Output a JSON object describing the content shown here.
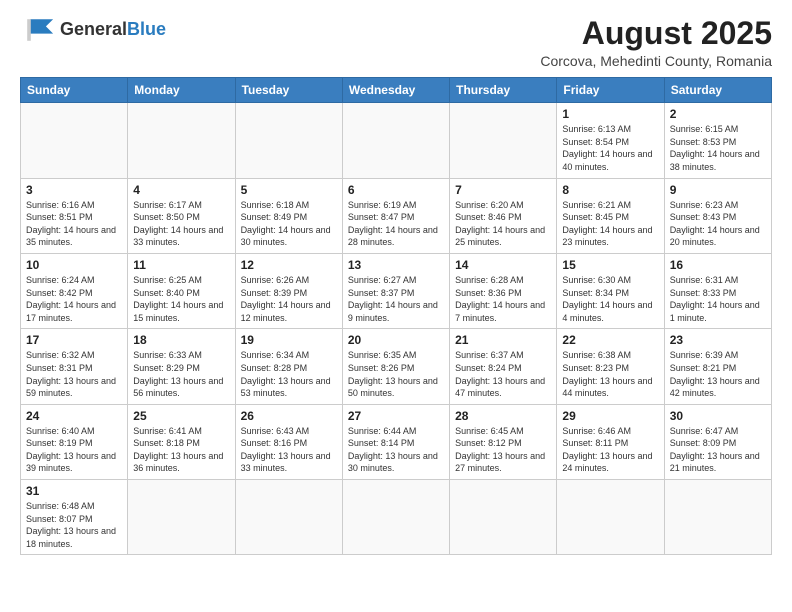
{
  "header": {
    "logo_general": "General",
    "logo_blue": "Blue",
    "main_title": "August 2025",
    "subtitle": "Corcova, Mehedinti County, Romania"
  },
  "weekdays": [
    "Sunday",
    "Monday",
    "Tuesday",
    "Wednesday",
    "Thursday",
    "Friday",
    "Saturday"
  ],
  "weeks": [
    [
      {
        "day": "",
        "info": ""
      },
      {
        "day": "",
        "info": ""
      },
      {
        "day": "",
        "info": ""
      },
      {
        "day": "",
        "info": ""
      },
      {
        "day": "",
        "info": ""
      },
      {
        "day": "1",
        "info": "Sunrise: 6:13 AM\nSunset: 8:54 PM\nDaylight: 14 hours and 40 minutes."
      },
      {
        "day": "2",
        "info": "Sunrise: 6:15 AM\nSunset: 8:53 PM\nDaylight: 14 hours and 38 minutes."
      }
    ],
    [
      {
        "day": "3",
        "info": "Sunrise: 6:16 AM\nSunset: 8:51 PM\nDaylight: 14 hours and 35 minutes."
      },
      {
        "day": "4",
        "info": "Sunrise: 6:17 AM\nSunset: 8:50 PM\nDaylight: 14 hours and 33 minutes."
      },
      {
        "day": "5",
        "info": "Sunrise: 6:18 AM\nSunset: 8:49 PM\nDaylight: 14 hours and 30 minutes."
      },
      {
        "day": "6",
        "info": "Sunrise: 6:19 AM\nSunset: 8:47 PM\nDaylight: 14 hours and 28 minutes."
      },
      {
        "day": "7",
        "info": "Sunrise: 6:20 AM\nSunset: 8:46 PM\nDaylight: 14 hours and 25 minutes."
      },
      {
        "day": "8",
        "info": "Sunrise: 6:21 AM\nSunset: 8:45 PM\nDaylight: 14 hours and 23 minutes."
      },
      {
        "day": "9",
        "info": "Sunrise: 6:23 AM\nSunset: 8:43 PM\nDaylight: 14 hours and 20 minutes."
      }
    ],
    [
      {
        "day": "10",
        "info": "Sunrise: 6:24 AM\nSunset: 8:42 PM\nDaylight: 14 hours and 17 minutes."
      },
      {
        "day": "11",
        "info": "Sunrise: 6:25 AM\nSunset: 8:40 PM\nDaylight: 14 hours and 15 minutes."
      },
      {
        "day": "12",
        "info": "Sunrise: 6:26 AM\nSunset: 8:39 PM\nDaylight: 14 hours and 12 minutes."
      },
      {
        "day": "13",
        "info": "Sunrise: 6:27 AM\nSunset: 8:37 PM\nDaylight: 14 hours and 9 minutes."
      },
      {
        "day": "14",
        "info": "Sunrise: 6:28 AM\nSunset: 8:36 PM\nDaylight: 14 hours and 7 minutes."
      },
      {
        "day": "15",
        "info": "Sunrise: 6:30 AM\nSunset: 8:34 PM\nDaylight: 14 hours and 4 minutes."
      },
      {
        "day": "16",
        "info": "Sunrise: 6:31 AM\nSunset: 8:33 PM\nDaylight: 14 hours and 1 minute."
      }
    ],
    [
      {
        "day": "17",
        "info": "Sunrise: 6:32 AM\nSunset: 8:31 PM\nDaylight: 13 hours and 59 minutes."
      },
      {
        "day": "18",
        "info": "Sunrise: 6:33 AM\nSunset: 8:29 PM\nDaylight: 13 hours and 56 minutes."
      },
      {
        "day": "19",
        "info": "Sunrise: 6:34 AM\nSunset: 8:28 PM\nDaylight: 13 hours and 53 minutes."
      },
      {
        "day": "20",
        "info": "Sunrise: 6:35 AM\nSunset: 8:26 PM\nDaylight: 13 hours and 50 minutes."
      },
      {
        "day": "21",
        "info": "Sunrise: 6:37 AM\nSunset: 8:24 PM\nDaylight: 13 hours and 47 minutes."
      },
      {
        "day": "22",
        "info": "Sunrise: 6:38 AM\nSunset: 8:23 PM\nDaylight: 13 hours and 44 minutes."
      },
      {
        "day": "23",
        "info": "Sunrise: 6:39 AM\nSunset: 8:21 PM\nDaylight: 13 hours and 42 minutes."
      }
    ],
    [
      {
        "day": "24",
        "info": "Sunrise: 6:40 AM\nSunset: 8:19 PM\nDaylight: 13 hours and 39 minutes."
      },
      {
        "day": "25",
        "info": "Sunrise: 6:41 AM\nSunset: 8:18 PM\nDaylight: 13 hours and 36 minutes."
      },
      {
        "day": "26",
        "info": "Sunrise: 6:43 AM\nSunset: 8:16 PM\nDaylight: 13 hours and 33 minutes."
      },
      {
        "day": "27",
        "info": "Sunrise: 6:44 AM\nSunset: 8:14 PM\nDaylight: 13 hours and 30 minutes."
      },
      {
        "day": "28",
        "info": "Sunrise: 6:45 AM\nSunset: 8:12 PM\nDaylight: 13 hours and 27 minutes."
      },
      {
        "day": "29",
        "info": "Sunrise: 6:46 AM\nSunset: 8:11 PM\nDaylight: 13 hours and 24 minutes."
      },
      {
        "day": "30",
        "info": "Sunrise: 6:47 AM\nSunset: 8:09 PM\nDaylight: 13 hours and 21 minutes."
      }
    ],
    [
      {
        "day": "31",
        "info": "Sunrise: 6:48 AM\nSunset: 8:07 PM\nDaylight: 13 hours and 18 minutes."
      },
      {
        "day": "",
        "info": ""
      },
      {
        "day": "",
        "info": ""
      },
      {
        "day": "",
        "info": ""
      },
      {
        "day": "",
        "info": ""
      },
      {
        "day": "",
        "info": ""
      },
      {
        "day": "",
        "info": ""
      }
    ]
  ]
}
